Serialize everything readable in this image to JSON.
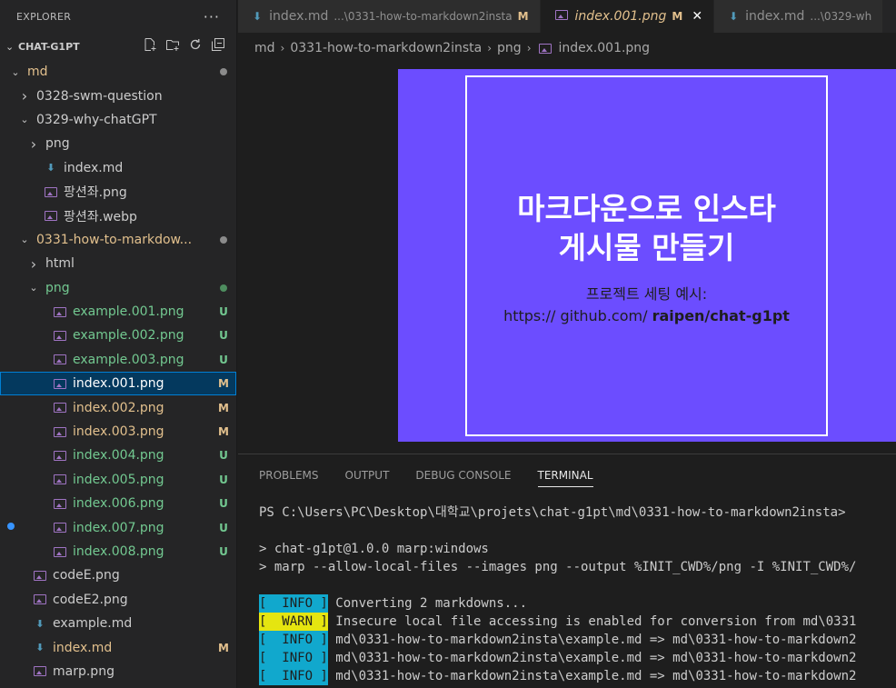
{
  "explorer": {
    "title": "EXPLORER",
    "more": "···",
    "section": "CHAT-G1PT",
    "actions": [
      "new-file-icon",
      "new-folder-icon",
      "refresh-icon",
      "collapse-all-icon"
    ]
  },
  "tree": [
    {
      "label": "md",
      "type": "folder",
      "open": true,
      "depth": 0,
      "color": "yellow",
      "dot": "#8b8b8b"
    },
    {
      "label": "0328-swm-question",
      "type": "folder",
      "open": false,
      "depth": 1,
      "color": "default"
    },
    {
      "label": "0329-why-chatGPT",
      "type": "folder",
      "open": true,
      "depth": 1,
      "color": "default"
    },
    {
      "label": "png",
      "type": "folder",
      "open": false,
      "depth": 2,
      "color": "default"
    },
    {
      "label": "index.md",
      "type": "md",
      "depth": 2,
      "color": "default"
    },
    {
      "label": "팡션좌.png",
      "type": "img",
      "depth": 2,
      "color": "default"
    },
    {
      "label": "팡션좌.webp",
      "type": "img",
      "depth": 2,
      "color": "default"
    },
    {
      "label": "0331-how-to-markdow...",
      "type": "folder",
      "open": true,
      "depth": 1,
      "color": "yellow",
      "dot": "#8b8b8b"
    },
    {
      "label": "html",
      "type": "folder",
      "open": false,
      "depth": 2,
      "color": "default"
    },
    {
      "label": "png",
      "type": "folder",
      "open": true,
      "depth": 2,
      "color": "green",
      "dot": "#4e8d5f"
    },
    {
      "label": "example.001.png",
      "type": "img",
      "depth": 3,
      "color": "green",
      "badge": "U"
    },
    {
      "label": "example.002.png",
      "type": "img",
      "depth": 3,
      "color": "green",
      "badge": "U"
    },
    {
      "label": "example.003.png",
      "type": "img",
      "depth": 3,
      "color": "green",
      "badge": "U"
    },
    {
      "label": "index.001.png",
      "type": "img",
      "depth": 3,
      "color": "white",
      "badge": "M",
      "selected": true
    },
    {
      "label": "index.002.png",
      "type": "img",
      "depth": 3,
      "color": "yellow",
      "badge": "M"
    },
    {
      "label": "index.003.png",
      "type": "img",
      "depth": 3,
      "color": "yellow",
      "badge": "M"
    },
    {
      "label": "index.004.png",
      "type": "img",
      "depth": 3,
      "color": "green",
      "badge": "U"
    },
    {
      "label": "index.005.png",
      "type": "img",
      "depth": 3,
      "color": "green",
      "badge": "U"
    },
    {
      "label": "index.006.png",
      "type": "img",
      "depth": 3,
      "color": "green",
      "badge": "U"
    },
    {
      "label": "index.007.png",
      "type": "img",
      "depth": 3,
      "color": "green",
      "badge": "U"
    },
    {
      "label": "index.008.png",
      "type": "img",
      "depth": 3,
      "color": "green",
      "badge": "U"
    },
    {
      "label": "codeE.png",
      "type": "img",
      "depth": 1,
      "color": "default"
    },
    {
      "label": "codeE2.png",
      "type": "img",
      "depth": 1,
      "color": "default"
    },
    {
      "label": "example.md",
      "type": "md",
      "depth": 1,
      "color": "default"
    },
    {
      "label": "index.md",
      "type": "md",
      "depth": 1,
      "color": "yellow",
      "badge": "M"
    },
    {
      "label": "marp.png",
      "type": "img",
      "depth": 1,
      "color": "default"
    }
  ],
  "tabs": [
    {
      "name": "index.md",
      "desc": "...\\0331-how-to-markdown2insta",
      "mark": "M",
      "icon": "markdown-icon",
      "active": false
    },
    {
      "name": "index.001.png",
      "desc": "",
      "mark": "M",
      "icon": "image-icon",
      "active": true
    },
    {
      "name": "index.md",
      "desc": "...\\0329-wh",
      "mark": "",
      "icon": "markdown-icon",
      "active": false
    }
  ],
  "breadcrumb": [
    "md",
    "0331-how-to-markdown2insta",
    "png",
    "index.001.png"
  ],
  "preview": {
    "title_line1": "마크다운으로 인스타",
    "title_line2": "게시물 만들기",
    "sub_line1": "프로젝트 세팅 예시:",
    "sub_prefix": "https:// github.com/ ",
    "sub_bold": "raipen/chat-g1pt",
    "bg": "#6c4dff"
  },
  "panel": {
    "tabs": [
      "PROBLEMS",
      "OUTPUT",
      "DEBUG CONSOLE",
      "TERMINAL"
    ],
    "active_tab": "TERMINAL",
    "terminal": [
      {
        "text": "PS C:\\Users\\PC\\Desktop\\대학교\\projets\\chat-g1pt\\md\\0331-how-to-markdown2insta>"
      },
      {
        "text": ""
      },
      {
        "text": "> chat-g1pt@1.0.0 marp:windows"
      },
      {
        "text": "> marp --allow-local-files --images png --output %INIT_CWD%/png -I %INIT_CWD%/"
      },
      {
        "text": ""
      },
      {
        "tag": "[  INFO ]",
        "level": "info",
        "text": " Converting 2 markdowns..."
      },
      {
        "tag": "[  WARN ]",
        "level": "warn",
        "text": " Insecure local file accessing is enabled for conversion from md\\0331"
      },
      {
        "tag": "[  INFO ]",
        "level": "info",
        "text": " md\\0331-how-to-markdown2insta\\example.md => md\\0331-how-to-markdown2"
      },
      {
        "tag": "[  INFO ]",
        "level": "info",
        "text": " md\\0331-how-to-markdown2insta\\example.md => md\\0331-how-to-markdown2"
      },
      {
        "tag": "[  INFO ]",
        "level": "info",
        "text": " md\\0331-how-to-markdown2insta\\example.md => md\\0331-how-to-markdown2"
      }
    ]
  }
}
